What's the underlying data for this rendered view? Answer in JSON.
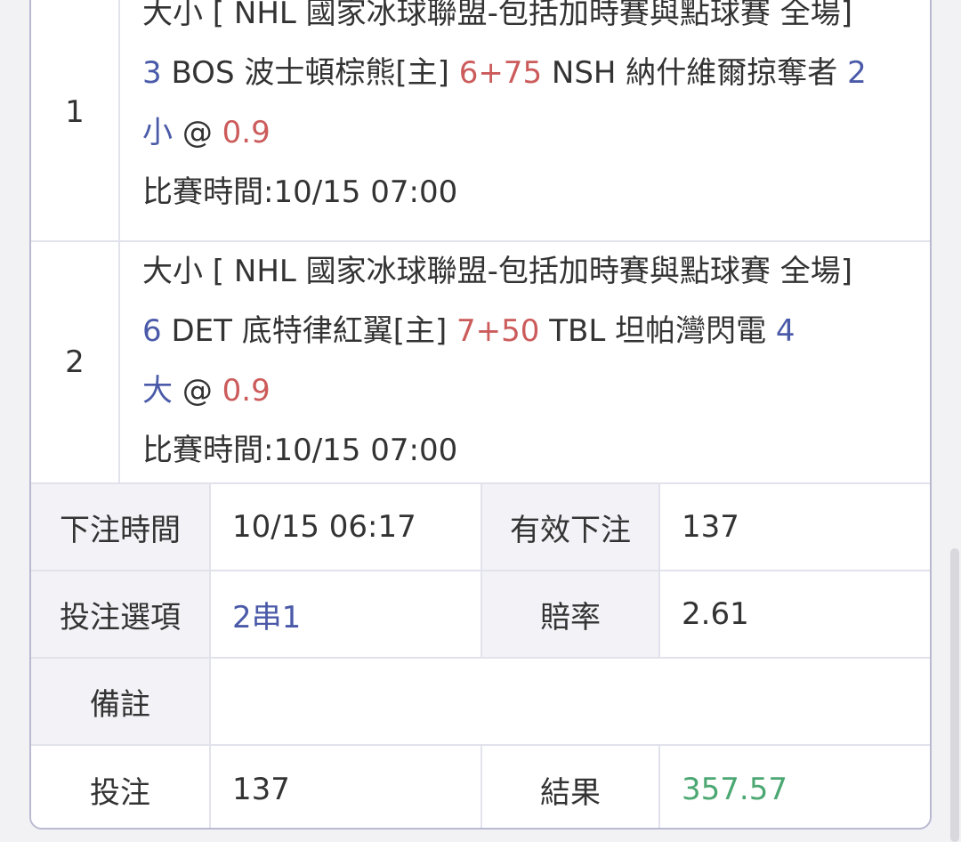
{
  "bets": [
    {
      "index": "1",
      "market": "大小 [ NHL 國家冰球聯盟-包括加時賽與點球賽 全場]",
      "home_score": "3",
      "home_team": "BOS 波士頓棕熊[主]",
      "line": "6+75",
      "away_team": "NSH 納什維爾掠奪者",
      "away_score": "2",
      "pick": "小",
      "at": "@",
      "odds": "0.9",
      "match_time": "比賽時間:10/15 07:00"
    },
    {
      "index": "2",
      "market": "大小 [ NHL 國家冰球聯盟-包括加時賽與點球賽 全場]",
      "home_score": "6",
      "home_team": "DET 底特律紅翼[主]",
      "line": "7+50",
      "away_team": "TBL 坦帕灣閃電",
      "away_score": "4",
      "pick": "大",
      "at": "@",
      "odds": "0.9",
      "match_time": "比賽時間:10/15 07:00"
    }
  ],
  "details": {
    "bet_time_label": "下注時間",
    "bet_time_value": "10/15 06:17",
    "valid_bet_label": "有效下注",
    "valid_bet_value": "137",
    "option_label": "投注選項",
    "option_value": "2串1",
    "odds_label": "賠率",
    "odds_value": "2.61",
    "remark_label": "備註",
    "remark_value": "",
    "stake_label": "投注",
    "stake_value": "137",
    "result_label": "結果",
    "result_value": "357.57"
  },
  "colors": {
    "blue": "#4a5aa8",
    "red": "#cc5b5b",
    "green": "#4ca872"
  }
}
